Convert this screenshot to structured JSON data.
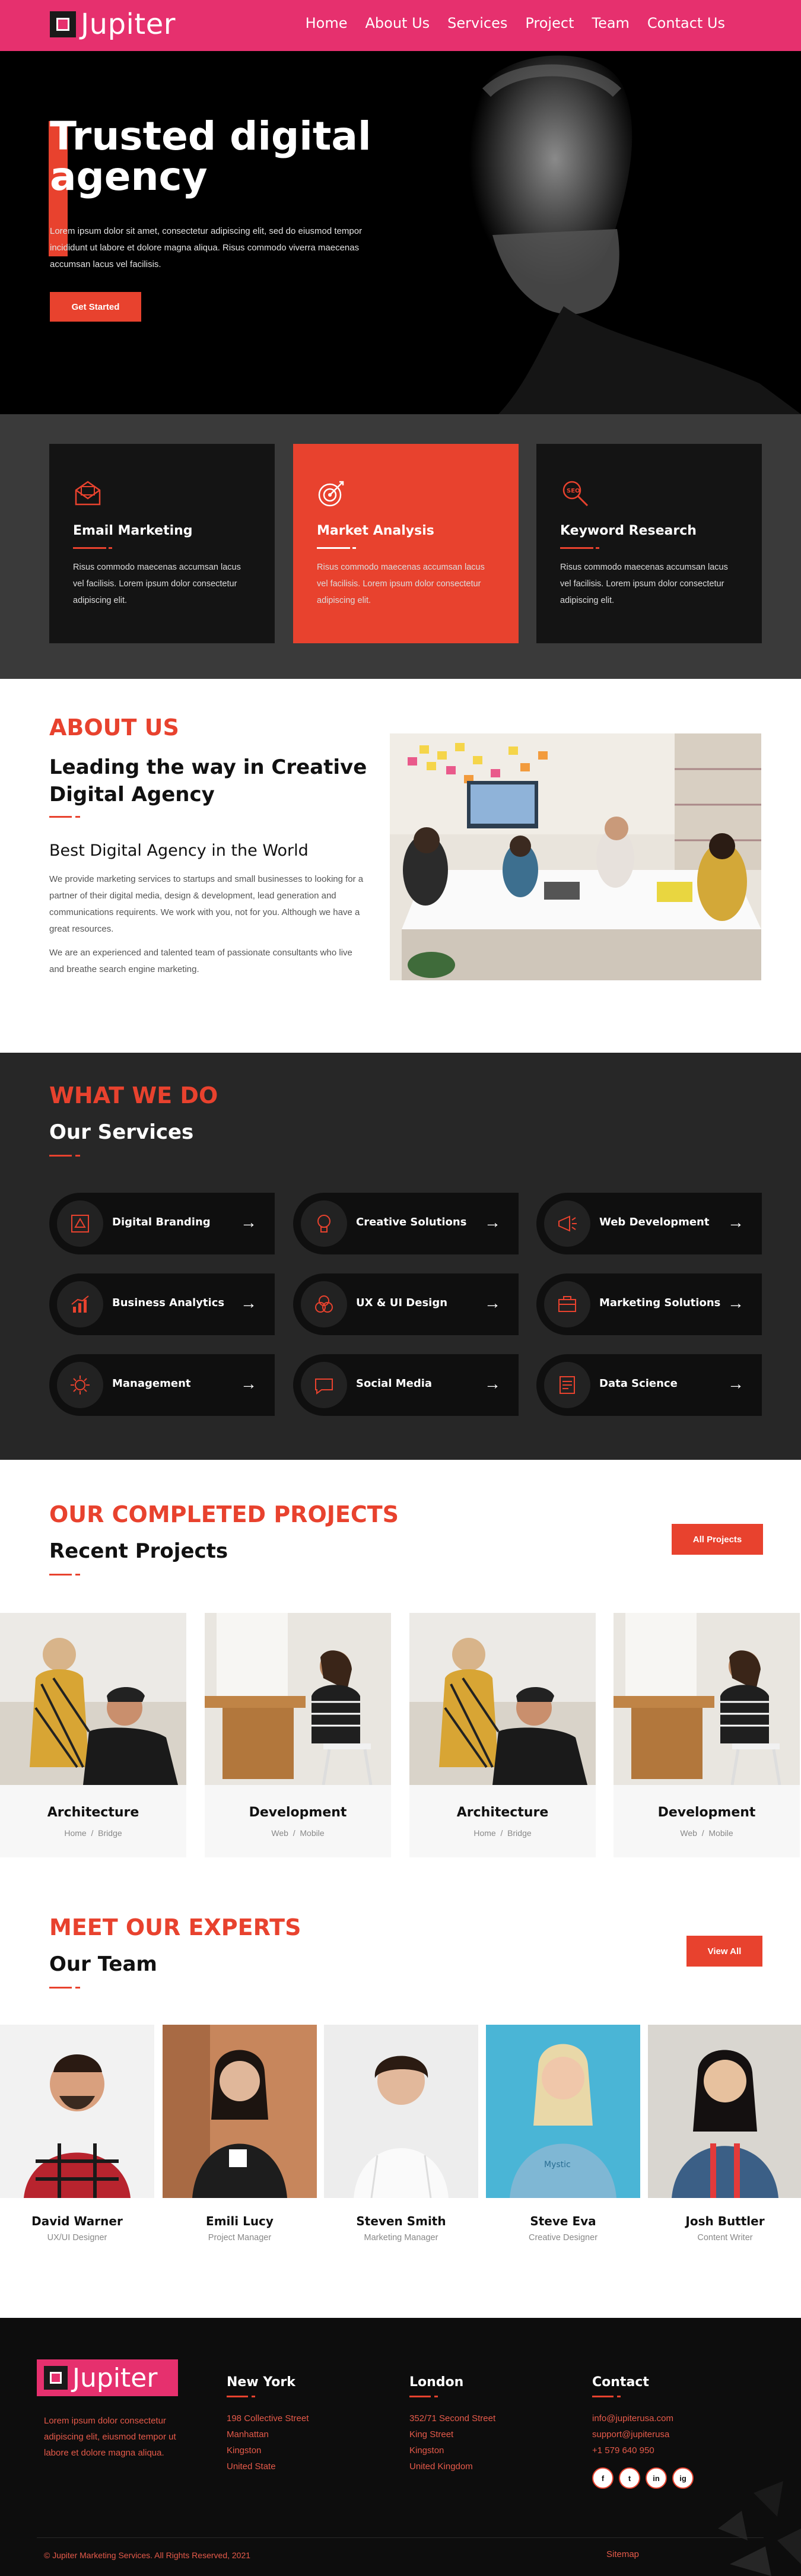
{
  "nav": {
    "brand": "Jupiter",
    "items": [
      "Home",
      "About Us",
      "Services",
      "Project",
      "Team",
      "Contact Us"
    ]
  },
  "hero": {
    "title": "Trusted digital agency",
    "text": "Lorem ipsum dolor sit amet, consectetur adipiscing elit, sed do eiusmod tempor incididunt ut labore et dolore magna aliqua. Risus commodo viverra maecenas accumsan lacus vel facilisis.",
    "button": "Get Started"
  },
  "features": [
    {
      "title": "Email Marketing",
      "text": "Risus commodo maecenas accumsan lacus vel facilisis. Lorem ipsum dolor consectetur adipiscing elit.",
      "icon": "email-icon"
    },
    {
      "title": "Market Analysis",
      "text": "Risus commodo maecenas accumsan lacus vel facilisis. Lorem ipsum dolor consectetur adipiscing elit.",
      "icon": "target-icon"
    },
    {
      "title": "Keyword Research",
      "text": "Risus commodo maecenas accumsan lacus vel facilisis. Lorem ipsum dolor consectetur adipiscing elit.",
      "icon": "seo-icon"
    }
  ],
  "about": {
    "heading": "ABOUT US",
    "subheading": "Leading the way in Creative Digital Agency",
    "tagline": "Best Digital Agency in the World",
    "p1": "We provide marketing services to startups and small businesses to looking for a partner of their digital media, design & development, lead generation and communications requirents. We work with you, not for you. Although we have a great resources.",
    "p2": "We are an experienced and talented team of passionate consultants who live and breathe search engine marketing."
  },
  "what_we_do": {
    "heading": "WHAT WE DO",
    "subheading": "Our Services",
    "services": [
      {
        "label": "Digital Branding",
        "icon": "branding-icon"
      },
      {
        "label": "Creative Solutions",
        "icon": "bulb-icon"
      },
      {
        "label": "Web Development",
        "icon": "megaphone-icon"
      },
      {
        "label": "Business Analytics",
        "icon": "chart-icon"
      },
      {
        "label": "UX & UI Design",
        "icon": "design-icon"
      },
      {
        "label": "Marketing Solutions",
        "icon": "briefcase-icon"
      },
      {
        "label": "Management",
        "icon": "gear-icon"
      },
      {
        "label": "Social Media",
        "icon": "chat-icon"
      },
      {
        "label": "Data Science",
        "icon": "data-icon"
      }
    ]
  },
  "projects": {
    "heading": "OUR COMPLETED PROJECTS",
    "subheading": "Recent Projects",
    "button": "All Projects",
    "items": [
      {
        "title": "Architecture",
        "tag1": "Home",
        "tag2": "Bridge"
      },
      {
        "title": "Development",
        "tag1": "Web",
        "tag2": "Mobile"
      },
      {
        "title": "Architecture",
        "tag1": "Home",
        "tag2": "Bridge"
      },
      {
        "title": "Development",
        "tag1": "Web",
        "tag2": "Mobile"
      }
    ]
  },
  "team": {
    "heading": "MEET OUR EXPERTS",
    "subheading": "Our Team",
    "button": "View All",
    "members": [
      {
        "name": "David Warner",
        "role": "UX/UI Designer"
      },
      {
        "name": "Emili Lucy",
        "role": "Project Manager"
      },
      {
        "name": "Steven Smith",
        "role": "Marketing Manager"
      },
      {
        "name": "Steve Eva",
        "role": "Creative Designer"
      },
      {
        "name": "Josh Buttler",
        "role": "Content Writer"
      }
    ]
  },
  "footer": {
    "brand": "Jupiter",
    "about": "Lorem ipsum dolor consectetur adipiscing elit, eiusmod tempor ut labore et dolore magna aliqua.",
    "cols": [
      {
        "title": "New York",
        "lines": [
          "198 Collective Street",
          "Manhattan",
          "Kingston",
          "United State"
        ]
      },
      {
        "title": "London",
        "lines": [
          "352/71 Second Street",
          "King Street",
          "Kingston",
          "United Kingdom"
        ]
      },
      {
        "title": "Contact",
        "lines": [
          "info@jupiterusa.com",
          "support@jupiterusa",
          "+1 579 640 950"
        ]
      }
    ],
    "socials": [
      "f",
      "t",
      "in",
      "ig"
    ],
    "copyright": "© Jupiter Marketing Services. All Rights Reserved, 2021",
    "sitemap": "Sitemap"
  },
  "colors": {
    "accent": "#e8422e",
    "nav": "#e6306e",
    "dark": "#272727"
  }
}
